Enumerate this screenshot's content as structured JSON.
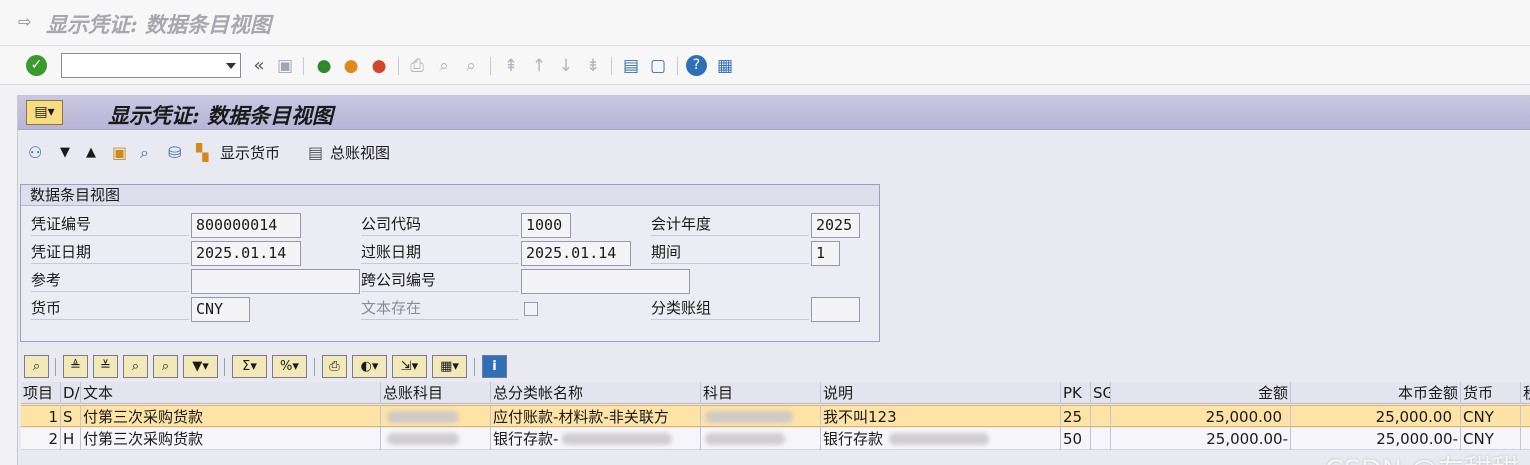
{
  "window": {
    "title": "显示凭证: 数据条目视图"
  },
  "system_toolbar": {
    "command_value": "",
    "icons": [
      "ok-icon",
      "back-double-icon",
      "save-icon",
      "back-icon",
      "exit-icon",
      "cancel-icon",
      "print-icon",
      "find-icon",
      "find-next-icon",
      "first-page-icon",
      "prev-page-icon",
      "next-page-icon",
      "last-page-icon",
      "new-session-icon",
      "shortcut-icon",
      "help-icon",
      "customize-icon"
    ]
  },
  "panel": {
    "title": "显示凭证: 数据条目视图"
  },
  "app_toolbar": {
    "show_currency": "显示货币",
    "gl_view": "总账视图"
  },
  "header": {
    "group_title": "数据条目视图",
    "doc_no_label": "凭证编号",
    "doc_no": "800000014",
    "company_label": "公司代码",
    "company": "1000",
    "fiscal_year_label": "会计年度",
    "fiscal_year": "2025",
    "doc_date_label": "凭证日期",
    "doc_date": "2025.01.14",
    "posting_date_label": "过账日期",
    "posting_date": "2025.01.14",
    "period_label": "期间",
    "period": "1",
    "reference_label": "参考",
    "reference": "",
    "cross_company_label": "跨公司编号",
    "cross_company": "",
    "currency_label": "货币",
    "currency": "CNY",
    "text_exists_label": "文本存在",
    "ledger_group_label": "分类账组",
    "ledger_group": ""
  },
  "table": {
    "columns": [
      "项目",
      "D/C",
      "文本",
      "总账科目",
      "总分类帐名称",
      "科目",
      "说明",
      "PK",
      "SG",
      "金额",
      "本币金额",
      "货币",
      "税"
    ],
    "rows": [
      {
        "item": "1",
        "dc": "S",
        "text": "付第三次采购货款",
        "gl_account": "",
        "gl_name": "应付账款-材料款-非关联方",
        "account": "",
        "desc": "我不叫123",
        "pk": "25",
        "sg": "",
        "amount": "25,000.00",
        "local_amount": "25,000.00",
        "currency": "CNY",
        "selected": true
      },
      {
        "item": "2",
        "dc": "H",
        "text": "付第三次采购货款",
        "gl_account": "",
        "gl_name": "银行存款-",
        "account": "",
        "desc": "银行存款",
        "pk": "50",
        "sg": "",
        "amount": "25,000.00-",
        "local_amount": "25,000.00-",
        "currency": "CNY",
        "selected": false
      }
    ]
  },
  "watermark": "CSDN @左甜甜"
}
